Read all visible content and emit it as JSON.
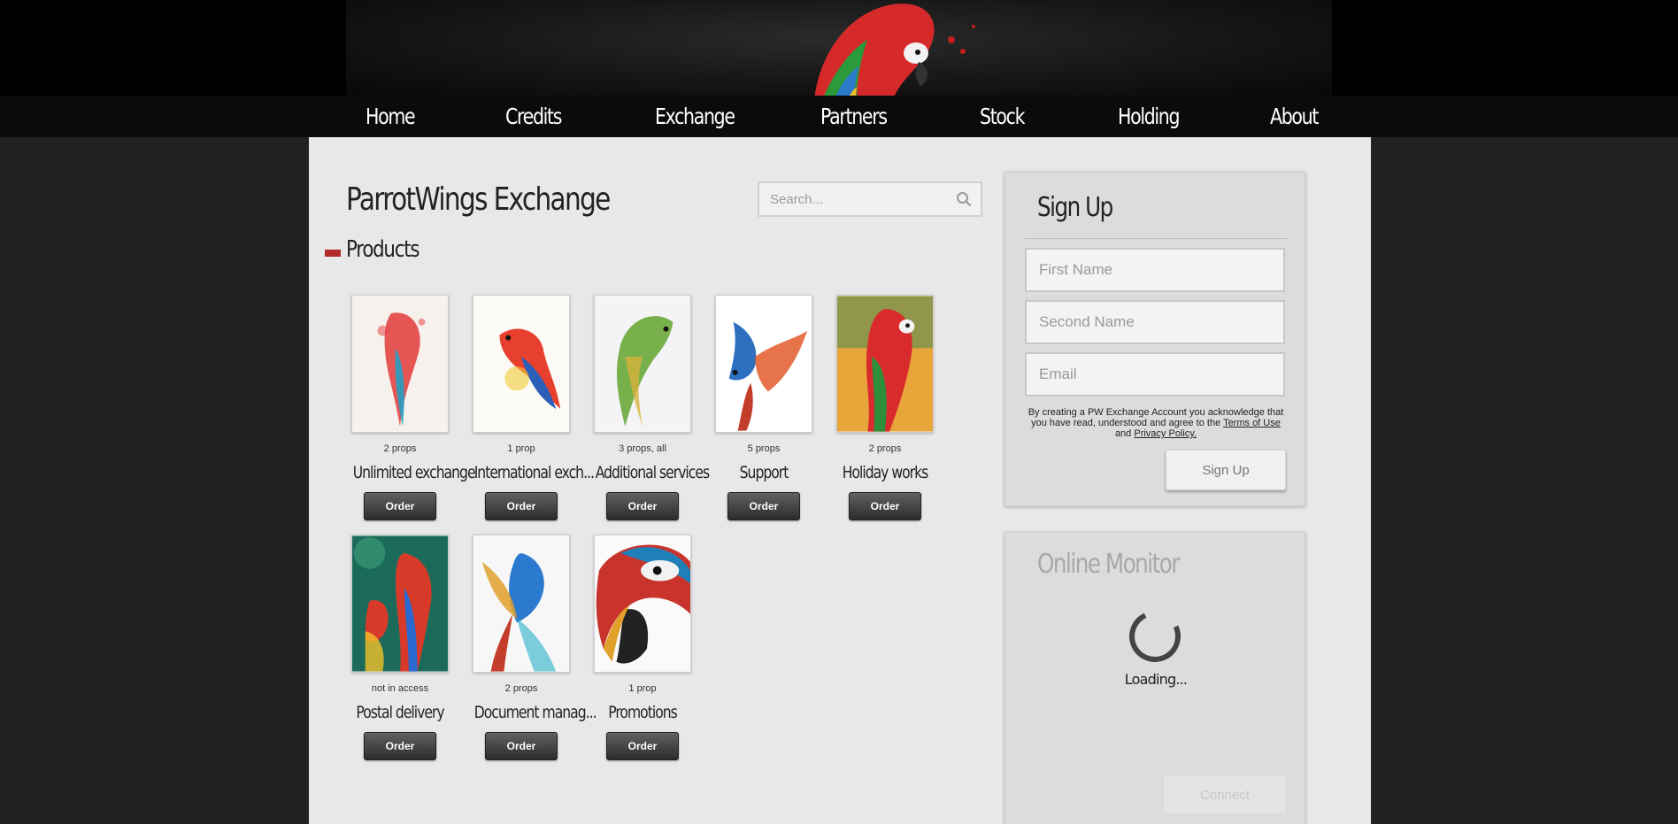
{
  "nav": {
    "items": [
      {
        "label": "Home"
      },
      {
        "label": "Credits"
      },
      {
        "label": "Exchange"
      },
      {
        "label": "Partners"
      },
      {
        "label": "Stock"
      },
      {
        "label": "Holding"
      },
      {
        "label": "About"
      }
    ]
  },
  "main": {
    "title": "ParrotWings Exchange",
    "search": {
      "placeholder": "Search..."
    },
    "section_title": "Products",
    "products": [
      {
        "props": "2 props",
        "name": "Unlimited exchange",
        "order_label": "Order",
        "colors": [
          "#e23a3a",
          "#1aa3c9"
        ]
      },
      {
        "props": "1 prop",
        "name": "International exch...",
        "order_label": "Order",
        "colors": [
          "#e8402e",
          "#f2c933"
        ]
      },
      {
        "props": "3 props, all",
        "name": "Additional services",
        "order_label": "Order",
        "colors": [
          "#6aa83a",
          "#d8b13a"
        ]
      },
      {
        "props": "5 props",
        "name": "Support",
        "order_label": "Order",
        "colors": [
          "#2f6fc0",
          "#e35a2a"
        ]
      },
      {
        "props": "2 props",
        "name": "Holiday works",
        "order_label": "Order",
        "colors": [
          "#d92b2b",
          "#2d8f3a"
        ]
      },
      {
        "props": "not in access",
        "name": "Postal delivery",
        "order_label": "Order",
        "colors": [
          "#1c6b5a",
          "#d83a2a"
        ]
      },
      {
        "props": "2 props",
        "name": "Document manag...",
        "order_label": "Order",
        "colors": [
          "#2b7ad0",
          "#e0a02a"
        ]
      },
      {
        "props": "1 prop",
        "name": "Promotions",
        "order_label": "Order",
        "colors": [
          "#c8342c",
          "#1f7fb8"
        ]
      }
    ]
  },
  "signup": {
    "title": "Sign Up",
    "first_name_placeholder": "First Name",
    "second_name_placeholder": "Second Name",
    "email_placeholder": "Email",
    "terms_text": "By creating a PW Exchange Account you acknowledge that you have read, understood and agree to the",
    "terms_link": "Terms of Use",
    "and_text": "and",
    "privacy_link": "Privacy Policy.",
    "button_label": "Sign Up"
  },
  "monitor": {
    "title": "Online Monitor",
    "loading_text": "Loading...",
    "connect_label": "Connect"
  },
  "colors": {
    "accent": "#b22a2a",
    "page_bg": "#222222",
    "panel_bg": "#e8e8e8"
  }
}
